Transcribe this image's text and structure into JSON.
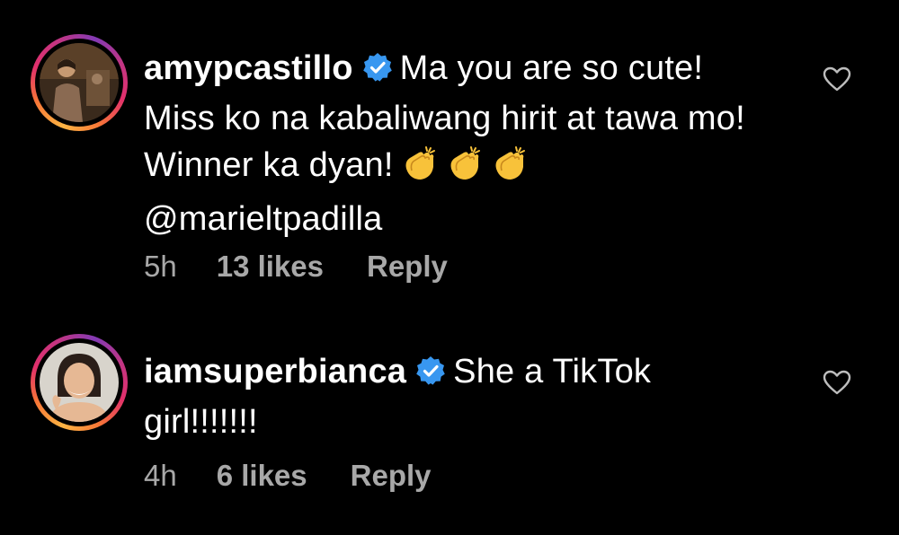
{
  "comments": [
    {
      "username": "amypcastillo",
      "text": "Ma you are so cute! Miss ko na kabaliwang hirit at tawa mo! Winner ka dyan!",
      "mention": "@marieltpadilla",
      "emojis": [
        "clapping-hands",
        "clapping-hands",
        "clapping-hands"
      ],
      "time": "5h",
      "likes": "13 likes",
      "reply": "Reply"
    },
    {
      "username": "iamsuperbianca",
      "text": "She a TikTok girl!!!!!!!",
      "time": "4h",
      "likes": "6 likes",
      "reply": "Reply"
    }
  ],
  "colors": {
    "background": "#000000",
    "text": "#ffffff",
    "meta": "#a8a8a8",
    "verified": "#3897f0"
  },
  "icons": [
    "verified-badge-icon",
    "heart-outline-icon",
    "clapping-hands-emoji"
  ]
}
